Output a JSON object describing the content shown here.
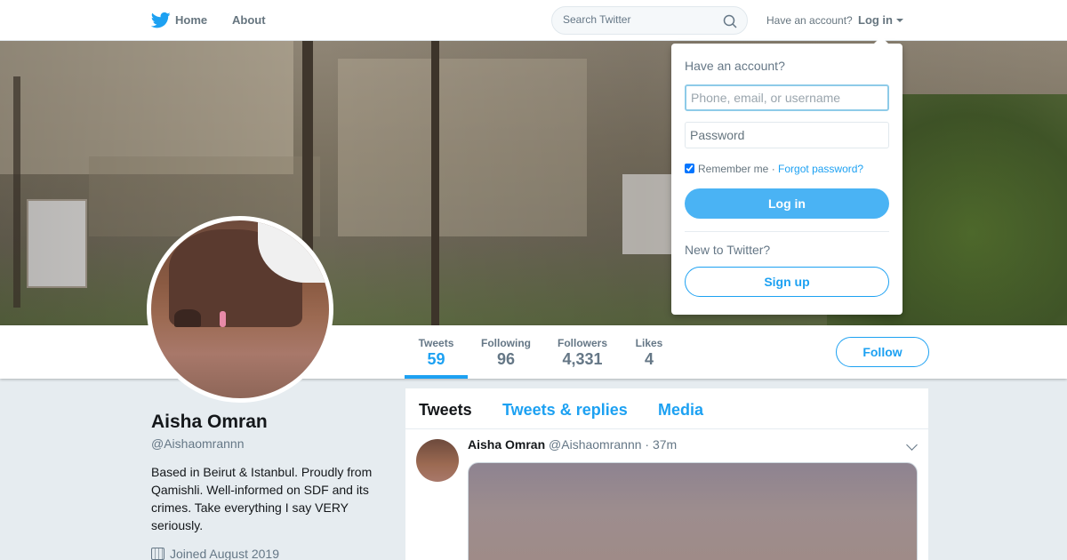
{
  "nav": {
    "home_label": "Home",
    "about_label": "About",
    "search_placeholder": "Search Twitter",
    "have_account": "Have an account?",
    "login_label": "Log in"
  },
  "profile": {
    "name": "Aisha Omran",
    "handle": "@Aishaomrannn",
    "bio": "Based in Beirut & Istanbul. Proudly from Qamishli. Well-informed on SDF and its crimes. Take everything I say VERY seriously.",
    "joined": "Joined August 2019",
    "follow_label": "Follow"
  },
  "stats": [
    {
      "label": "Tweets",
      "value": "59",
      "active": true
    },
    {
      "label": "Following",
      "value": "96",
      "active": false
    },
    {
      "label": "Followers",
      "value": "4,331",
      "active": false
    },
    {
      "label": "Likes",
      "value": "4",
      "active": false
    }
  ],
  "timeline": {
    "tabs": [
      {
        "label": "Tweets",
        "active": true
      },
      {
        "label": "Tweets & replies",
        "active": false
      },
      {
        "label": "Media",
        "active": false
      }
    ],
    "tweet": {
      "name": "Aisha Omran",
      "handle": "@Aishaomrannn",
      "dot": "·",
      "time": "37m"
    }
  },
  "login_dropdown": {
    "title": "Have an account?",
    "username_placeholder": "Phone, email, or username",
    "password_placeholder": "Password",
    "remember_label": "Remember me",
    "separator": "·",
    "forgot_label": "Forgot password?",
    "login_button": "Log in",
    "new_label": "New to Twitter?",
    "signup_button": "Sign up",
    "remember_checked": true
  },
  "colors": {
    "accent": "#1da1f2",
    "background": "#e6ecf0"
  },
  "icons": [
    "twitter-logo",
    "search-icon",
    "caret-down-icon",
    "calendar-icon",
    "chevron-down-icon"
  ]
}
